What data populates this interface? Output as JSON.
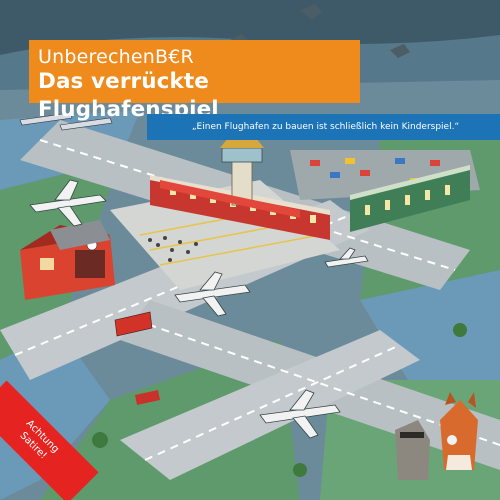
{
  "cover": {
    "series_title": "UnberechenB€R",
    "main_title": "Das verrückte Flughafenspiel",
    "quote": "„Einen Flughafen zu bauen ist schließlich kein Kinderspiel.“",
    "ribbon_line1": "Achtung",
    "ribbon_line2": "Satire!"
  },
  "colors": {
    "title_bg": "#ef8a1c",
    "quote_bg": "#1c73b6",
    "ribbon_bg": "#e52421",
    "runway": "#b9c0c3",
    "grass": "#5f9a6c",
    "water": "#6b9ab8"
  },
  "illustration": {
    "icons": [
      "airplane-icon",
      "control-tower-icon",
      "fire-station-icon",
      "train-icon",
      "fox-icon",
      "raccoon-icon",
      "bird-icon",
      "bus-icon",
      "car-icon"
    ]
  }
}
